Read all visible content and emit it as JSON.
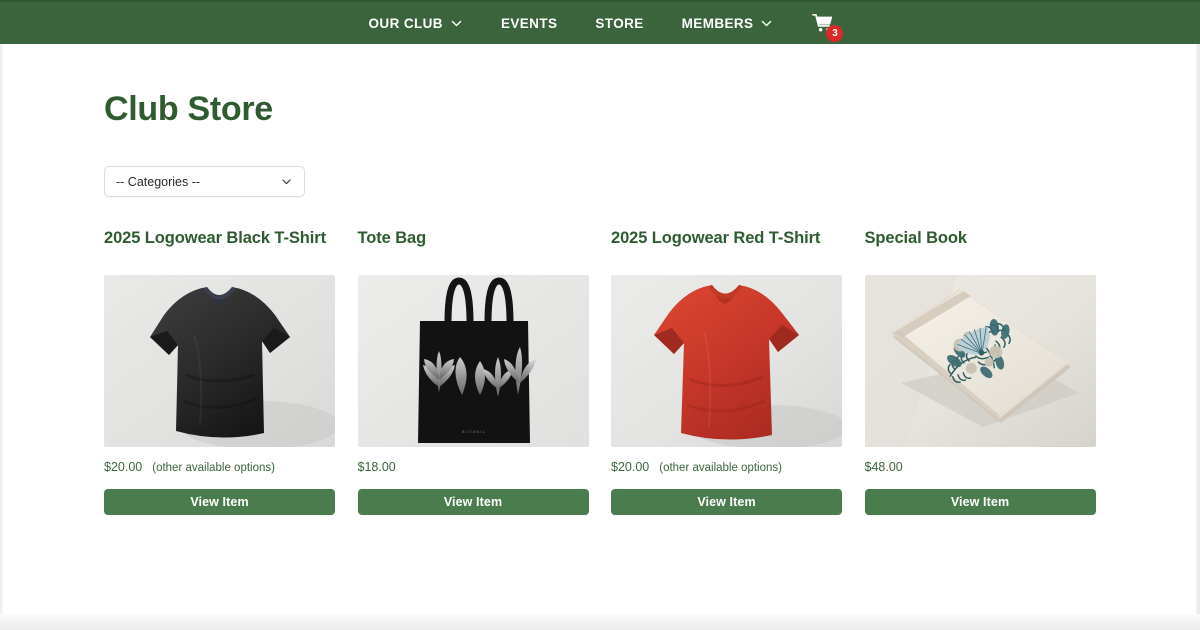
{
  "navbar": {
    "background_color": "#3b643d",
    "items": [
      {
        "label": "OUR CLUB",
        "has_dropdown": true
      },
      {
        "label": "EVENTS",
        "has_dropdown": false
      },
      {
        "label": "STORE",
        "has_dropdown": false
      },
      {
        "label": "MEMBERS",
        "has_dropdown": true
      }
    ],
    "cart": {
      "icon": "shopping-cart-icon",
      "badge_count": "3",
      "badge_color": "#dc2828"
    }
  },
  "main": {
    "title": "Club Store",
    "title_color": "#2f5b31",
    "category_filter": {
      "selected": "-- Categories --",
      "icon": "chevron-down-icon"
    },
    "products": [
      {
        "title": "2025 Logowear Black T-Shirt",
        "price": "$20.00",
        "options_note": "(other available options)",
        "button_label": "View Item",
        "image": "black-tshirt"
      },
      {
        "title": "Tote Bag",
        "price": "$18.00",
        "options_note": "",
        "button_label": "View Item",
        "image": "black-tote-bag"
      },
      {
        "title": "2025 Logowear Red T-Shirt",
        "price": "$20.00",
        "options_note": "(other available options)",
        "button_label": "View Item",
        "image": "red-tshirt"
      },
      {
        "title": "Special Book",
        "price": "$48.00",
        "options_note": "",
        "button_label": "View Item",
        "image": "floral-book"
      }
    ]
  },
  "colors": {
    "brand_green": "#3b643d",
    "button_green": "#4a7c4e",
    "heading_green": "#2f5b31",
    "badge_red": "#dc2828"
  }
}
